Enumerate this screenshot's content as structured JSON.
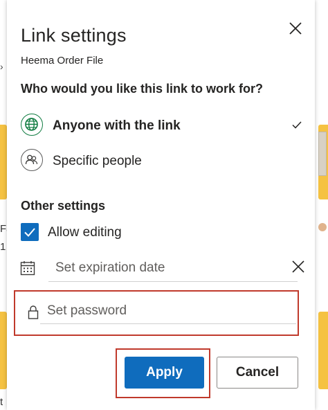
{
  "background": {
    "left_text_1": "Fa",
    "left_text_2": "1",
    "left_text_3": "t"
  },
  "dialog": {
    "title": "Link settings",
    "file_name": "Heema Order File",
    "question": "Who would you like this link to work for?",
    "options": [
      {
        "label": "Anyone with the link",
        "icon": "globe-icon",
        "selected": true
      },
      {
        "label": "Specific people",
        "icon": "people-icon",
        "selected": false
      }
    ],
    "other_settings_heading": "Other settings",
    "allow_editing": {
      "label": "Allow editing",
      "checked": true
    },
    "expiration": {
      "placeholder": "Set expiration date",
      "value": ""
    },
    "password": {
      "placeholder": "Set password",
      "value": ""
    },
    "buttons": {
      "apply": "Apply",
      "cancel": "Cancel"
    },
    "colors": {
      "accent": "#0f6cbd",
      "globe": "#107c41",
      "highlight": "#c0392b"
    }
  }
}
